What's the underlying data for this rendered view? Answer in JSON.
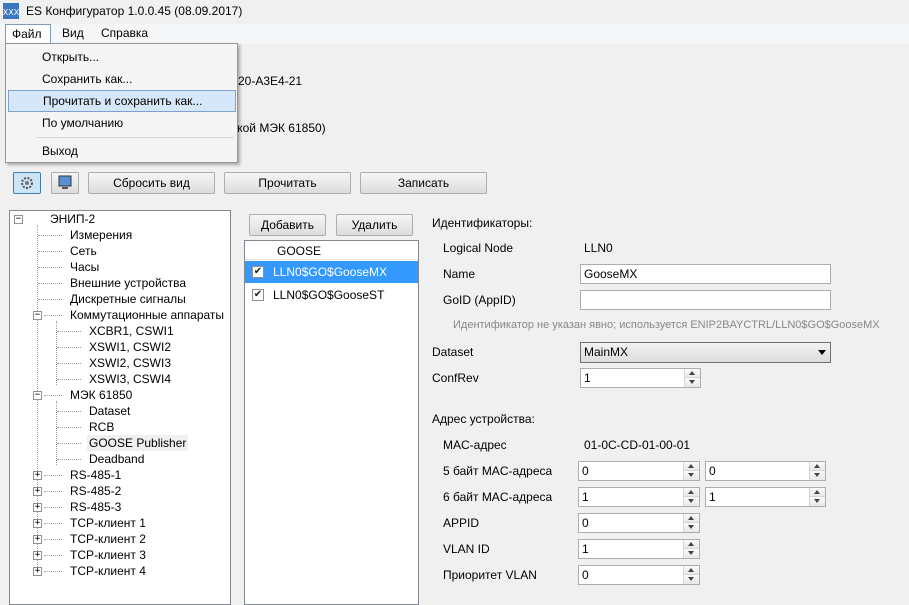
{
  "window": {
    "title": "ES Конфигуратор 1.0.0.45 (08.09.2017)"
  },
  "menu": {
    "file": "Файл",
    "view": "Вид",
    "help": "Справка"
  },
  "file_menu": {
    "open": "Открыть...",
    "save_as": "Сохранить как...",
    "read_and_save_as": "Прочитать и сохранить как...",
    "defaults": "По умолчанию",
    "exit": "Выход"
  },
  "background_text": {
    "device_id": "20-A3E4-21",
    "protocol": "ккой МЭК 61850)"
  },
  "toolbar": {
    "reset_view": "Сбросить вид",
    "read": "Прочитать",
    "write": "Записать"
  },
  "tree": {
    "root": "ЭНИП-2",
    "items": [
      "Измерения",
      "Сеть",
      "Часы",
      "Внешние устройства",
      "Дискретные сигналы",
      "Коммутационные аппараты",
      "XCBR1, CSWI1",
      "XSWI1, CSWI2",
      "XSWI2, CSWI3",
      "XSWI3, CSWI4",
      "МЭК 61850",
      "Dataset",
      "RCB",
      "GOOSE Publisher",
      "Deadband",
      "RS-485-1",
      "RS-485-2",
      "RS-485-3",
      "TCP-клиент 1",
      "TCP-клиент 2",
      "TCP-клиент 3",
      "TCP-клиент 4"
    ]
  },
  "goose_panel": {
    "add": "Добавить",
    "delete": "Удалить",
    "header": "GOOSE",
    "rows": [
      "LLN0$GO$GooseMX",
      "LLN0$GO$GooseST"
    ]
  },
  "identifiers": {
    "section": "Идентификаторы:",
    "logical_node_label": "Logical Node",
    "logical_node_value": "LLN0",
    "name_label": "Name",
    "name_value": "GooseMX",
    "goid_label": "GoID (AppID)",
    "goid_value": "",
    "hint": "Идентификатор не указан явно; используется ENIP2BAYCTRL/LLN0$GO$GooseMX"
  },
  "dataset": {
    "label": "Dataset",
    "value": "MainMX"
  },
  "confrev": {
    "label": "ConfRev",
    "value": "1"
  },
  "address": {
    "section": "Адрес устройства:",
    "mac_label": "MAC-адрес",
    "mac_value": "01-0C-CD-01-00-01",
    "byte5_label": "5 байт MAC-адреса",
    "byte5_a": "0",
    "byte5_b": "0",
    "byte6_label": "6 байт MAC-адреса",
    "byte6_a": "1",
    "byte6_b": "1",
    "appid_label": "APPID",
    "appid_value": "0",
    "vlan_label": "VLAN ID",
    "vlan_value": "1",
    "priority_label": "Приоритет VLAN",
    "priority_value": "0"
  }
}
